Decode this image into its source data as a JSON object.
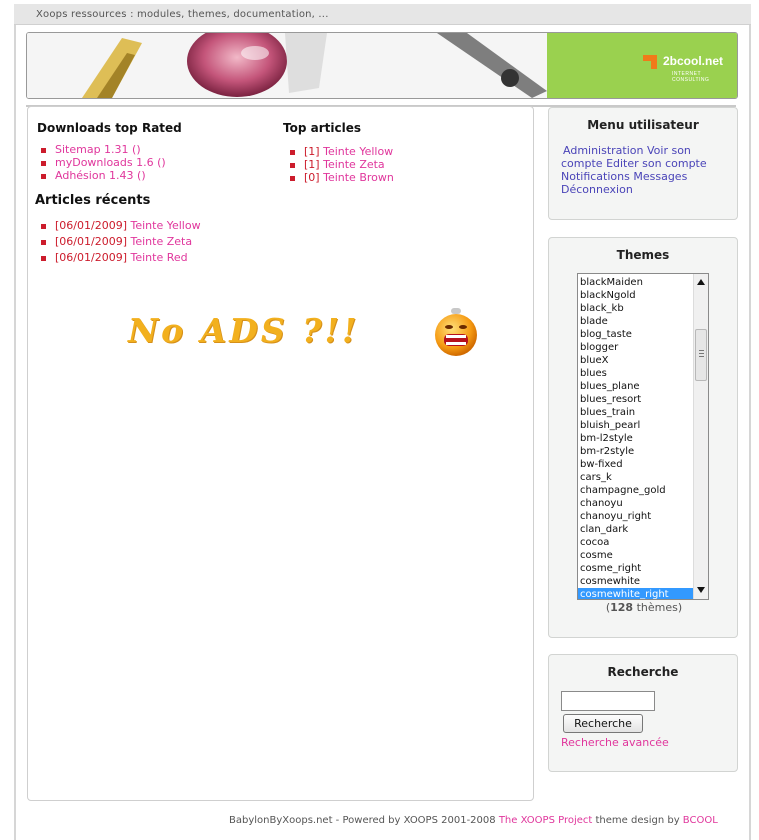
{
  "topbar": {
    "text": "Xoops ressources : modules, themes, documentation, ..."
  },
  "banner": {
    "brand": "2bcool.net",
    "tagline": "INTERNET CONSULTING"
  },
  "downloads": {
    "title": "Downloads top Rated",
    "items": [
      "Sitemap 1.31 ()",
      "myDownloads 1.6 ()",
      "Adhésion 1.43 ()"
    ]
  },
  "top_articles": {
    "title": "Top articles",
    "items": [
      {
        "count": "[1]",
        "label": "Teinte Yellow"
      },
      {
        "count": "[1]",
        "label": "Teinte Zeta"
      },
      {
        "count": "[0]",
        "label": "Teinte Brown"
      }
    ]
  },
  "recent": {
    "title": "Articles récents",
    "items": [
      {
        "date": "[06/01/2009]",
        "label": "Teinte Yellow"
      },
      {
        "date": "[06/01/2009]",
        "label": "Teinte Zeta"
      },
      {
        "date": "[06/01/2009]",
        "label": "Teinte Red"
      }
    ]
  },
  "ads": {
    "text": "No ADS ?!!"
  },
  "user_menu": {
    "title": "Menu utilisateur",
    "links": [
      "Administration",
      "Voir son compte",
      "Editer son compte",
      "Notifications",
      "Messages",
      "Déconnexion"
    ]
  },
  "themes": {
    "title": "Themes",
    "list": [
      "blackMaiden",
      "blackNgold",
      "black_kb",
      "blade",
      "blog_taste",
      "blogger",
      "blueX",
      "blues",
      "blues_plane",
      "blues_resort",
      "blues_train",
      "bluish_pearl",
      "bm-l2style",
      "bm-r2style",
      "bw-fixed",
      "cars_k",
      "champagne_gold",
      "chanoyu",
      "chanoyu_right",
      "clan_dark",
      "cocoa",
      "cosme",
      "cosme_right",
      "cosmewhite",
      "cosmewhite_right"
    ],
    "selected": "cosmewhite_right",
    "count_open": "(",
    "count": "128",
    "count_suffix": " thèmes)"
  },
  "search": {
    "title": "Recherche",
    "button": "Recherche",
    "advanced": "Recherche avancée"
  },
  "footer": {
    "prefix": "BabylonByXoops.net - Powered by XOOPS 2001-2008 ",
    "project_link": "The XOOPS Project",
    "middle": " theme design by ",
    "designer_link": "BCOOL"
  },
  "colors": {
    "accent_pink": "#e0369c",
    "bullet_red": "#cc1c2c",
    "banner_green": "#9ad14f",
    "selection_blue": "#3399ff"
  }
}
